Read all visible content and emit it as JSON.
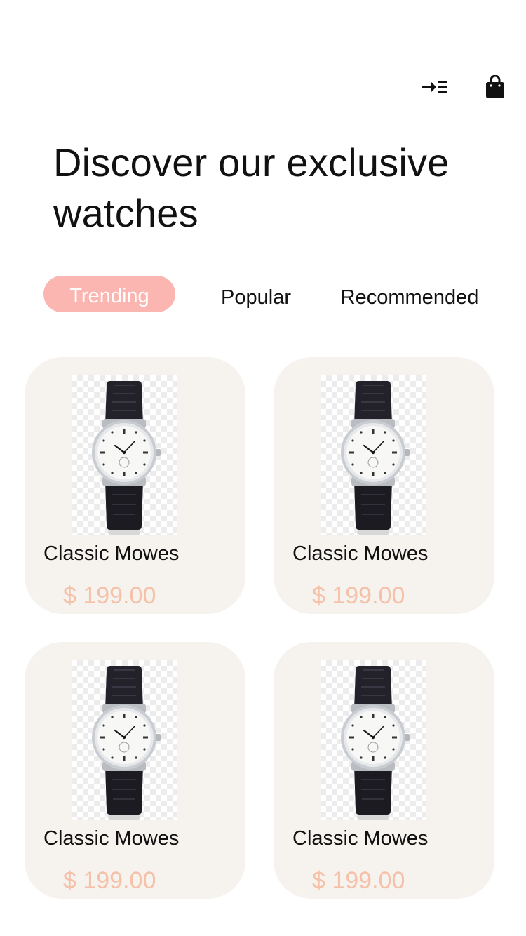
{
  "header": {
    "menu_icon": "menu-arrow-icon",
    "bag_icon": "shopping-bag-icon"
  },
  "title": {
    "line1": "Discover our exclusive",
    "line2": "watches"
  },
  "tabs": [
    {
      "label": "Trending",
      "active": true
    },
    {
      "label": "Popular",
      "active": false
    },
    {
      "label": "Recommended",
      "active": false
    }
  ],
  "products": [
    {
      "name": "Classic Mowes",
      "price": "$ 199.00",
      "image": "wristwatch-image"
    },
    {
      "name": "Classic Mowes",
      "price": "$ 199.00",
      "image": "wristwatch-image"
    },
    {
      "name": "Classic Mowes",
      "price": "$ 199.00",
      "image": "wristwatch-image"
    },
    {
      "name": "Classic Mowes",
      "price": "$ 199.00",
      "image": "wristwatch-image"
    }
  ],
  "colors": {
    "active_tab_bg": "#fcb6b2",
    "card_bg": "#f6f3ef",
    "price": "#f5c1a9",
    "text": "#111111"
  }
}
